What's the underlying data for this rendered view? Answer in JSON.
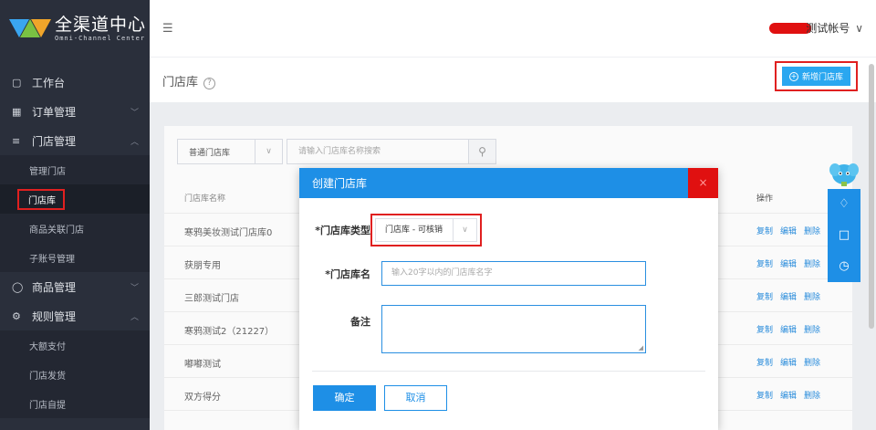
{
  "app": {
    "title": "全渠道中心",
    "subtitle": "Omni-Channel Center"
  },
  "sidebar": {
    "items": [
      {
        "label": "工作台",
        "icon": "monitor-icon",
        "type": "menu"
      },
      {
        "label": "订单管理",
        "icon": "order-icon",
        "type": "menu",
        "chevron": "﹀"
      },
      {
        "label": "门店管理",
        "icon": "list-icon",
        "type": "menu",
        "chevron": "︿"
      },
      {
        "label": "管理门店",
        "type": "sub"
      },
      {
        "label": "门店库",
        "type": "sub",
        "active": true
      },
      {
        "label": "商品关联门店",
        "type": "sub"
      },
      {
        "label": "子账号管理",
        "type": "sub"
      },
      {
        "label": "商品管理",
        "icon": "bag-icon",
        "type": "menu",
        "chevron": "﹀"
      },
      {
        "label": "规则管理",
        "icon": "gear-icon",
        "type": "menu",
        "chevron": "︿"
      },
      {
        "label": "大额支付",
        "type": "sub"
      },
      {
        "label": "门店发货",
        "type": "sub"
      },
      {
        "label": "门店自提",
        "type": "sub"
      }
    ]
  },
  "header": {
    "account_label": "测试帐号"
  },
  "page": {
    "title": "门店库",
    "help": "?",
    "add_button": "新增门店库"
  },
  "filter": {
    "select_value": "普通门店库",
    "search_placeholder": "请输入门店库名称搜索"
  },
  "table": {
    "headers": {
      "name": "门店库名称",
      "ops": "操作"
    },
    "ops": [
      "复制",
      "编辑",
      "删除"
    ],
    "rows": [
      {
        "name": "寒鸦美妆测试门店库0"
      },
      {
        "name": "获朋专用"
      },
      {
        "name": "三郎测试门店"
      },
      {
        "name": "寒鸦测试2（21227）"
      },
      {
        "name": "嘟嘟测试"
      },
      {
        "name": "双方得分"
      }
    ]
  },
  "modal": {
    "title": "创建门店库",
    "close": "×",
    "type_label": "*门店库类型",
    "type_value": "门店库 - 可核销",
    "name_label": "*门店库名",
    "name_placeholder": "输入20字以内的门店库名字",
    "remark_label": "备注",
    "ok_label": "确定",
    "cancel_label": "取消"
  },
  "colors": {
    "primary": "#1e8fe6",
    "sidebar_bg": "#2a2f3b",
    "highlight": "#e02020"
  }
}
